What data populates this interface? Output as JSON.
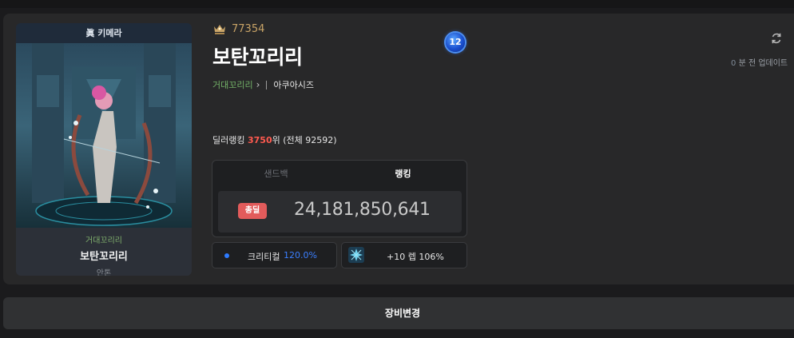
{
  "portrait": {
    "header": "眞 키메라",
    "adventure": "거대꼬리리",
    "name": "보탄꼬리리",
    "server": "안톤"
  },
  "character": {
    "fame": "77354",
    "name": "보탄꼬리리",
    "adventure": "거대꼬리리",
    "server": "아쿠아시즈",
    "level_badge": "12"
  },
  "update": {
    "minutes": "0",
    "suffix": "분 전 업데이트"
  },
  "ranking": {
    "prefix": "딜러랭킹 ",
    "rank": "3750",
    "suffix": "위 (전체 92592)"
  },
  "damage": {
    "tabs": [
      "샌드백",
      "랭킹"
    ],
    "active_tab": "랭킹",
    "badge": "총딜",
    "value": "24,181,850,641"
  },
  "stats": {
    "crit_label": "크리티컬",
    "crit_value": "120.0%",
    "level_text": "+10 렙 106%"
  },
  "equip_button": "장비변경",
  "colors": {
    "rank_red": "#ff5a4f",
    "adventure_green": "#72b167",
    "crit_blue": "#3b7fff",
    "fame_gold": "#c9a467",
    "badge_red": "#e25b5b"
  },
  "icons": {
    "fame": "fame-crown-icon",
    "refresh": "refresh-icon",
    "chevron": "chevron-right-icon",
    "crit": "dot-icon",
    "level": "level-rune-icon"
  }
}
